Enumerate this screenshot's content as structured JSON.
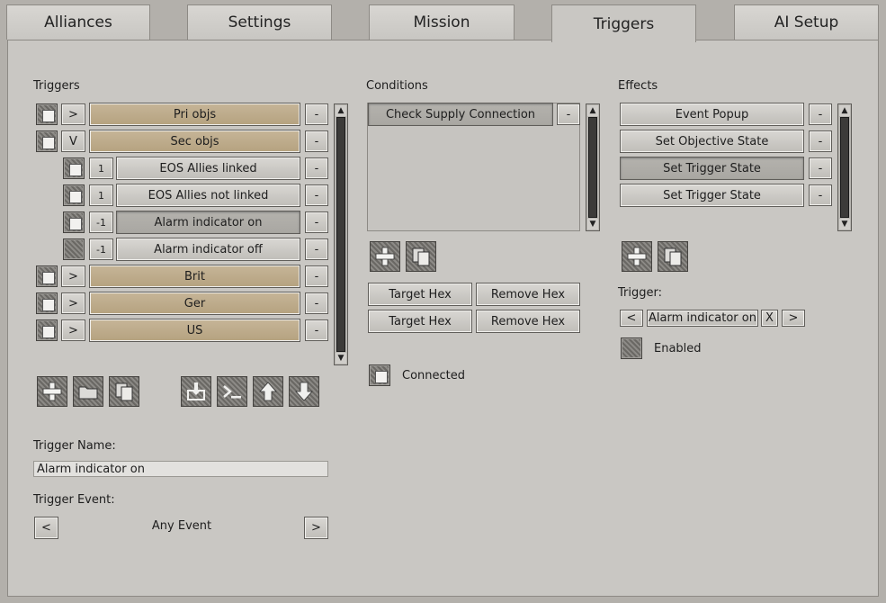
{
  "tabs": [
    "Alliances",
    "Settings",
    "Mission",
    "Triggers",
    "AI Setup"
  ],
  "triggers": {
    "header": "Triggers",
    "rows": [
      {
        "expander": ">",
        "name": "Pri objs",
        "remove": "-"
      },
      {
        "expander": "V",
        "name": "Sec objs",
        "remove": "-"
      },
      {
        "expander": "1",
        "name": "EOS Allies linked",
        "remove": "-"
      },
      {
        "expander": "1",
        "name": "EOS Allies not linked",
        "remove": "-"
      },
      {
        "expander": "-1",
        "name": "Alarm indicator on",
        "remove": "-"
      },
      {
        "expander": "-1",
        "name": "Alarm indicator off",
        "remove": "-"
      },
      {
        "expander": ">",
        "name": "Brit",
        "remove": "-"
      },
      {
        "expander": ">",
        "name": "Ger",
        "remove": "-"
      },
      {
        "expander": ">",
        "name": "US",
        "remove": "-"
      }
    ],
    "name_label": "Trigger Name:",
    "name_value": "Alarm indicator on",
    "event_label": "Trigger Event:",
    "event_value": "Any Event",
    "prev": "<",
    "next": ">"
  },
  "conditions": {
    "header": "Conditions",
    "items": [
      {
        "name": "Check Supply Connection",
        "remove": "-"
      }
    ],
    "target_hex_1": "Target Hex",
    "remove_hex_1": "Remove Hex",
    "target_hex_2": "Target Hex",
    "remove_hex_2": "Remove Hex",
    "connected_label": "Connected"
  },
  "effects": {
    "header": "Effects",
    "items": [
      {
        "name": "Event Popup",
        "remove": "-"
      },
      {
        "name": "Set Objective State",
        "remove": "-"
      },
      {
        "name": "Set Trigger State",
        "remove": "-"
      },
      {
        "name": "Set Trigger State",
        "remove": "-"
      }
    ],
    "trigger_label": "Trigger:",
    "trigger_prev": "<",
    "trigger_value": "Alarm indicator on",
    "trigger_clear": "X",
    "trigger_next": ">",
    "enabled_label": "Enabled"
  },
  "scroll": {
    "up": "▲",
    "down": "▼"
  }
}
